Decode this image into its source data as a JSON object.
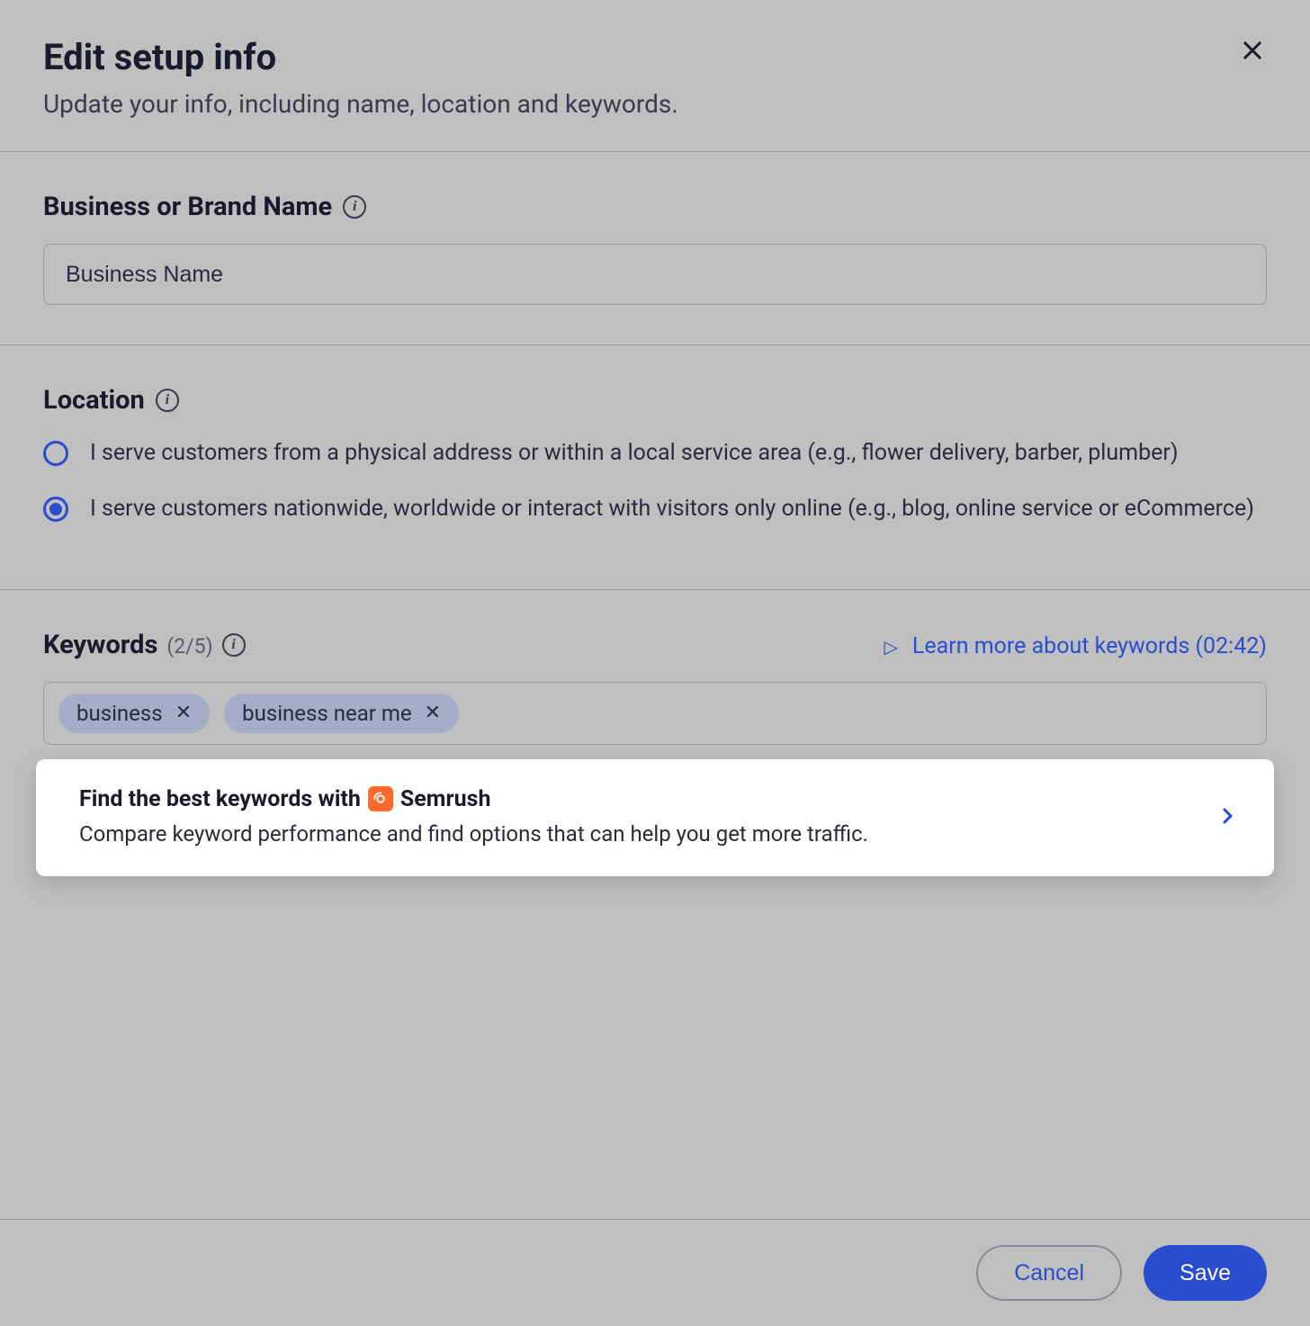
{
  "header": {
    "title": "Edit setup info",
    "subtitle": "Update your info, including name, location and keywords."
  },
  "business": {
    "label": "Business or Brand Name",
    "value": "Business Name"
  },
  "location": {
    "label": "Location",
    "options": [
      {
        "text": "I serve customers from a physical address or within a local service area (e.g., flower delivery, barber, plumber)",
        "checked": false
      },
      {
        "text": "I serve customers nationwide, worldwide or interact with visitors only online (e.g., blog, online service or eCommerce)",
        "checked": true
      }
    ]
  },
  "keywords": {
    "label": "Keywords",
    "count_text": "(2/5)",
    "learn_more": "Learn more about keywords (02:42)",
    "chips": [
      "business",
      "business near me"
    ]
  },
  "promo": {
    "title_prefix": "Find the best keywords with",
    "brand": "Semrush",
    "desc": "Compare keyword performance and find options that can help you get more traffic."
  },
  "footer": {
    "cancel": "Cancel",
    "save": "Save"
  }
}
